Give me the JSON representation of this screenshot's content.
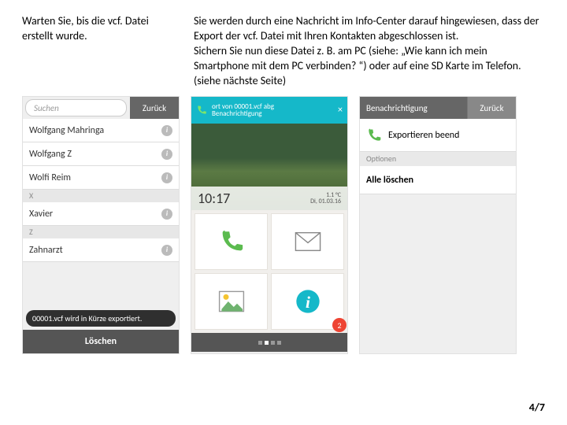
{
  "captions": {
    "left": "Warten Sie, bis die vcf. Datei erstellt wurde.",
    "right": "Sie werden durch eine Nachricht im Info-Center darauf hingewiesen, dass der Export der vcf. Datei mit Ihren Kontakten abgeschlossen ist.\nSichern Sie nun diese Datei z. B. am PC (siehe: „Wie kann ich mein Smartphone mit dem PC verbinden? “) oder auf eine SD Karte im Telefon. (siehe nächste Seite)"
  },
  "phone1": {
    "search_placeholder": "Suchen",
    "back": "Zurück",
    "contacts": [
      "Wolfgang Mahringa",
      "Wolfgang Z",
      "Wolfi Reim"
    ],
    "sepX": "X",
    "contactX": "Xavier",
    "sepZ": "Z",
    "contactZ": "Zahnarzt",
    "toast": "00001.vcf wird in Kürze exportiert.",
    "delete": "Löschen"
  },
  "phone2": {
    "notif_line1": "ort von 00001.vcf abg",
    "notif_line2": "Benachrichtigung",
    "time": "10:17",
    "temp": "1.1 °C",
    "date": "Di, 01.03.16",
    "badge": "2"
  },
  "phone3": {
    "title": "Benachrichtigung",
    "back": "Zurück",
    "item": "Exportieren beend",
    "options": "Optionen",
    "clear": "Alle löschen"
  },
  "page": "4/7"
}
